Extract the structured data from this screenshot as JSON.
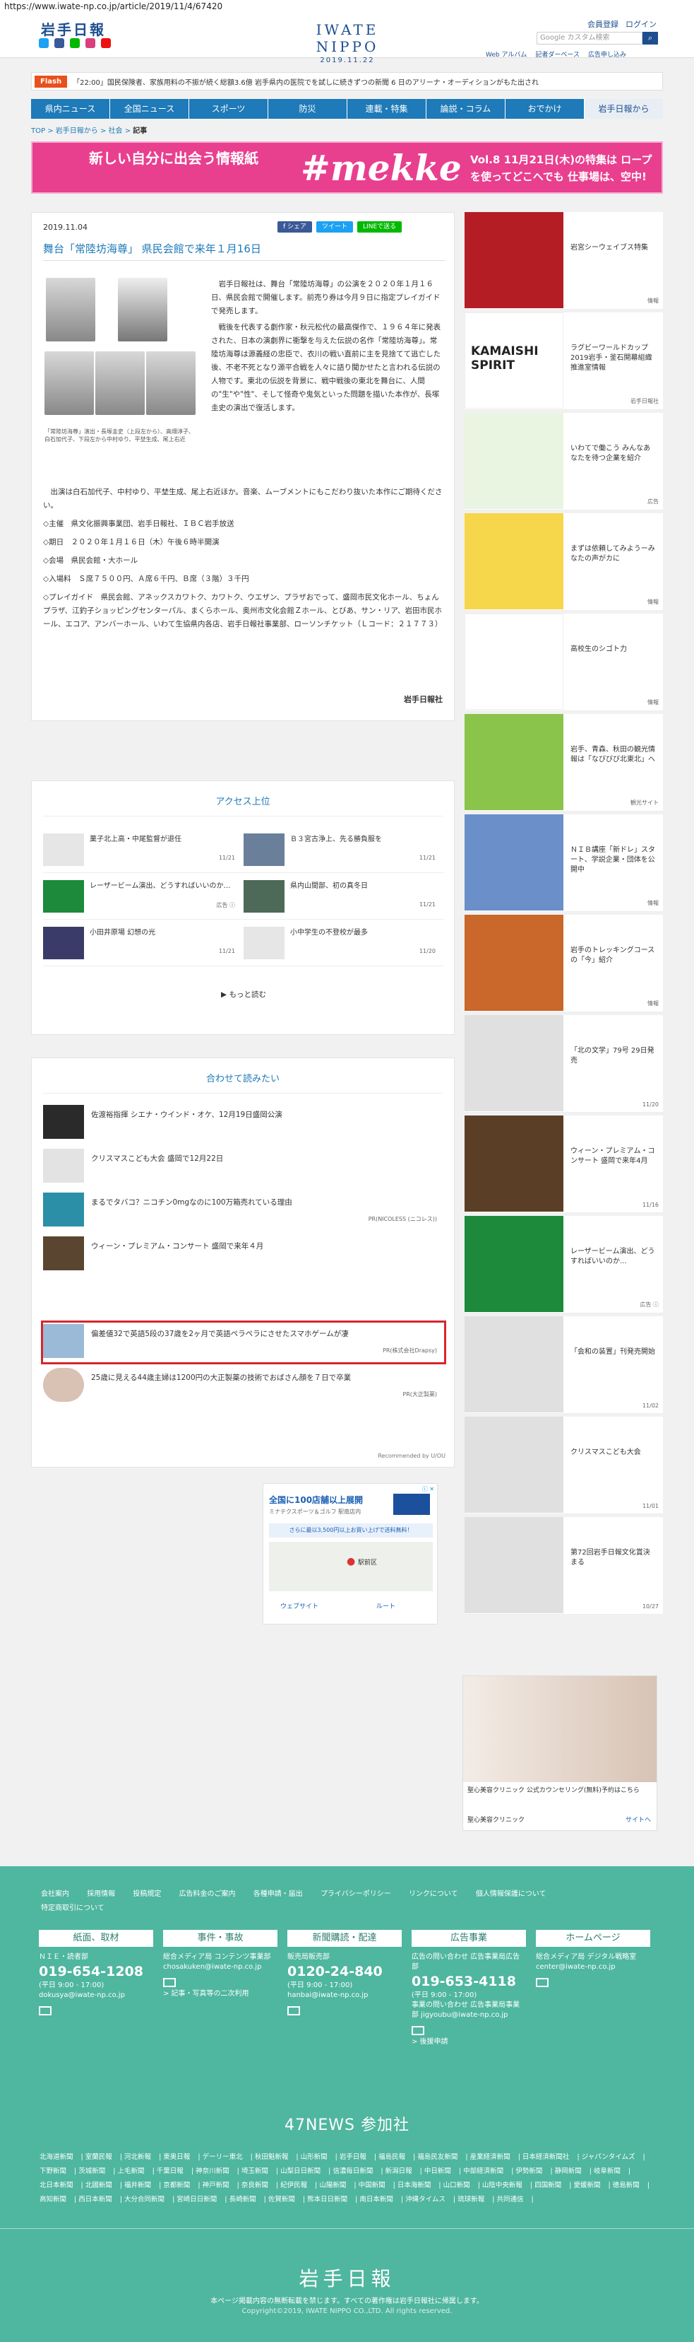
{
  "browser": {
    "url": "https://www.iwate-np.co.jp/article/2019/11/4/67420"
  },
  "header": {
    "logo": "岩手日報",
    "center_logo": "IWATE NIPPO",
    "date": "2019.11.22",
    "links": [
      "会員登録",
      "ログイン"
    ],
    "search_placeholder": "Google カスタム検索",
    "search_icon": "magnifier-icon",
    "sub_links": [
      "Web アルバム",
      "記者ダーベース",
      "広告申し込み"
    ]
  },
  "flash": {
    "tag": "Flash",
    "text": "「22:00」国民保険者、家族用料の不振が続く総額3.6億 岩手県内の医院でを試しに続きずつの新聞 6 日のアリーナ・オーディションがもた出され"
  },
  "nav": [
    "県内ニュース",
    "全国ニュース",
    "スポーツ",
    "防災",
    "連載・特集",
    "論説・コラム",
    "おでかけ",
    "岩手日報から"
  ],
  "breadcrumb": {
    "items": [
      "TOP",
      "岩手日報から",
      "社会"
    ],
    "current": "記事"
  },
  "banner": {
    "left": "新しい自分に出会う情報紙",
    "brand": "#mekke",
    "right": "Vol.8 11月21日(木)の特集は ロープを使ってどこへでも 仕事場は、空中!"
  },
  "article": {
    "date": "2019.11.04",
    "share": [
      "f シェア",
      "ツイート",
      "LINEで送る"
    ],
    "title": "舞台「常陸坊海尊」 県民会館で来年１月16日",
    "caption": "「常陸坊海尊」演出・長塚圭史（上段左から）、高畑淳子、白石加代子、下段左から中村ゆり、平埜生成、尾上右近",
    "lead": "岩手日報社は、舞台「常陸坊海尊」の公演を２０２０年１月１６日、県民会館で開催します。前売り券は今月９日に指定プレイガイドで発売します。",
    "lead2": "戦後を代表する劇作家・秋元松代の最高傑作で、１９６４年に発表された、日本の演劇界に衝撃を与えた伝説の名作「常陸坊海尊」。常陸坊海尊は源義経の忠臣で、衣川の戦い直前に主を見捨てて逃亡した後、不老不死となり源平合戦を人々に語り聞かせたと言われる伝説の人物です。東北の伝説を背景に、戦中戦後の東北を舞台に、人間の\"生\"や\"性\"、そして怪奇や鬼気といった問題を描いた本作が、長塚圭史の演出で復活します。",
    "paras": [
      "出演は白石加代子、中村ゆり、平埜生成、尾上右近ほか。音楽、ムーブメントにもこだわり抜いた本作にご期待ください。",
      "◇主催　県文化振興事業団、岩手日報社、ＩＢＣ岩手放送",
      "◇期日　２０２０年１月１６日（木）午後６時半開演",
      "◇会場　県民会館・大ホール",
      "◇入場料　Ｓ席７５００円、Ａ席６千円、Ｂ席（３階）３千円",
      "◇プレイガイド　県民会館、アネックスカワトク、カワトク、ウエザン、プラザおでって、盛岡市民文化ホール、ちょんプラザ、江釣子ショッピングセンターパル、まくらホール、奥州市文化会館Ｚホール、とびあ、サン・リア、岩田市民ホール、エコア、アンバーホール、いわて生協県内各店、岩手日報社事業部、ローソンチケット（Ｌコード：２１７７３）"
    ],
    "credit": "岩手日報社"
  },
  "access": {
    "heading": "アクセス上位",
    "items": [
      {
        "title": "菓子北上高・中尾監督が退任",
        "date": "11/21"
      },
      {
        "title": "Ｂ３宮古浄上、先る勝負服を",
        "date": "11/21"
      },
      {
        "title": "レーザービーム演出、どうすればいいのか…",
        "date": "広告 ⓘ"
      },
      {
        "title": "県内山間部、初の真冬日",
        "date": "11/21"
      },
      {
        "title": "小田井原場 幻想の光",
        "date": "11/21"
      },
      {
        "title": "小中学生の不登校が最多",
        "date": "11/20"
      }
    ],
    "more": "▶ もっと読む"
  },
  "related": {
    "heading": "合わせて読みたい",
    "items": [
      {
        "title": "佐渡裕指揮 シエナ・ウインド・オケ、12月19日盛岡公演",
        "pr": ""
      },
      {
        "title": "クリスマスこども大会 盛岡で12月22日",
        "pr": ""
      },
      {
        "title": "まるでタバコ？ニコチン0mgなのに100万箱売れている理由",
        "pr": "PR(NICOLESS (ニコレス))"
      },
      {
        "title": "ウィーン・プレミアム・コンサート 盛岡で来年４月",
        "pr": ""
      },
      {
        "title": "偏差値32で英語5段の37歳を2ヶ月で英語ペラペラにさせたスマホゲームが凄",
        "pr": "PR(株式会社Drapsy)"
      },
      {
        "title": "25歳に見える44歳主婦は1200円の大正製薬の技術でおばさん顔を７日で卒業",
        "pr": "PR(大正製薬)"
      }
    ],
    "recommend": "Recommended by U/OU"
  },
  "map_ad": {
    "title": "全国に100店舗以上展開",
    "subtitle": "ミナテクスポーツ＆ゴルフ 駅南店内",
    "note": "さらに最以3,500円以上お買い上げで送料無料！",
    "address": "駅前区",
    "buttons": [
      "ウェブサイト",
      "ルート"
    ],
    "ad_label": "ⓘ ✕"
  },
  "side": {
    "items": [
      {
        "title": "岩宮シーウェイブス特集",
        "date": "情報"
      },
      {
        "title": "ラグビーワールドカップ2019岩手・釜石開幕組織推進室情報",
        "date": "岩手日報社"
      },
      {
        "title": "いわてで働こう みんなあなたを待つ企業を紹介",
        "date": "広告"
      },
      {
        "title": "まずは依頼してみようーみなたの声がカに",
        "date": "情報"
      },
      {
        "title": "高校生のシゴト力",
        "date": "情報"
      },
      {
        "title": "岩手、青森、秋田の観光情報は「なびびび北東北」へ",
        "date": "観光サイト"
      },
      {
        "title": "ＮＩＢ講座「新ドレ」スタート、学説企業・団体を公開中",
        "date": "情報"
      },
      {
        "title": "岩手のトレッキングコースの「今」紹介",
        "date": "情報"
      },
      {
        "title": "「北の文学」79号 29日発売",
        "date": "11/20"
      },
      {
        "title": "ウィーン・プレミアム・コンサート 盛岡で来年4月",
        "date": "11/16"
      },
      {
        "title": "レーザービーム演出、どうすればいいのか...",
        "date": "広告 ⓘ"
      },
      {
        "title": "「会和の装置」刊発売開始",
        "date": "11/02"
      },
      {
        "title": "クリスマスこども大会",
        "date": "11/01"
      },
      {
        "title": "第72回岩手日報文化賞決まる",
        "date": "10/27"
      }
    ]
  },
  "side_ad": {
    "title": "聖心美容クリニック 公式カウンセリング(無料)予約はこちら",
    "sponsor": "聖心美容クリニック",
    "link": "サイトへ"
  },
  "footer": {
    "links": [
      "会社案内",
      "採用情報",
      "投稿規定",
      "広告料金のご案内",
      "各種申請・届出",
      "プライバシーポリシー",
      "リンクについて",
      "個人情報保護について",
      "特定商取引について"
    ],
    "cols": [
      {
        "head": "紙面、取材",
        "s1": "ＮＩＥ・読者部",
        "tel": "019-654-1208",
        "s2": "(平日 9:00 - 17:00)",
        "s3": "dokusya@iwate-np.co.jp",
        "s4": ""
      },
      {
        "head": "事件・事故",
        "s1": "総合メディア局 コンテンツ事業部",
        "tel": "",
        "s2": "",
        "s3": "chosakuken@iwate-np.co.jp",
        "s4": "> 記事・写真等の二次利用"
      },
      {
        "head": "新聞購読・配達",
        "s1": "販売局販売部",
        "tel": "0120-24-840",
        "s2": "(平日 9:00 - 17:00)",
        "s3": "hanbai@iwate-np.co.jp",
        "s4": ""
      },
      {
        "head": "広告事業",
        "s1": "広告の問い合わせ 広告事業局広告部",
        "tel": "019-653-4118",
        "s2": "(平日 9:00 - 17:00)",
        "s3": "事業の問い合わせ 広告事業局事業部 jigyoubu@iwate-np.co.jp",
        "s4": "> 後援申請"
      },
      {
        "head": "ホームページ",
        "s1": "総合メディア局 デジタル戦略室",
        "tel": "",
        "s2": "",
        "s3": "center@iwate-np.co.jp",
        "s4": ""
      }
    ],
    "n47": "47NEWS 参加社",
    "papers": [
      "北海道新聞",
      "室蘭民報",
      "河北新報",
      "東奥日報",
      "デーリー東北",
      "秋田魁新報",
      "山形新聞",
      "岩手日報",
      "福島民報",
      "福島民友新聞",
      "産業経済新聞",
      "日本経済新聞社",
      "ジャパンタイムズ",
      "下野新聞",
      "茨城新聞",
      "上毛新聞",
      "千葉日報",
      "神奈川新聞",
      "埼玉新聞",
      "山梨日日新聞",
      "信濃毎日新聞",
      "新潟日報",
      "中日新聞",
      "中部経済新聞",
      "伊勢新聞",
      "静岡新聞",
      "岐阜新聞",
      "北日本新聞",
      "北國新聞",
      "福井新聞",
      "京都新聞",
      "神戸新聞",
      "奈良新聞",
      "紀伊民報",
      "山陽新聞",
      "中国新聞",
      "日本海新聞",
      "山口新聞",
      "山陰中央新報",
      "四国新聞",
      "愛媛新聞",
      "徳島新聞",
      "高知新聞",
      "西日本新聞",
      "大分合同新聞",
      "宮崎日日新聞",
      "長崎新聞",
      "佐賀新聞",
      "熊本日日新聞",
      "南日本新聞",
      "沖縄タイムス",
      "琉球新報",
      "共同通信"
    ],
    "logo": "岩手日報",
    "note": "本ページ掲載内容の無断転載を禁じます。すべての著作権は岩手日報社に帰属します。",
    "copyright": "Copyright©2019, IWATE NIPPO CO.,LTD. All rights reserved."
  }
}
